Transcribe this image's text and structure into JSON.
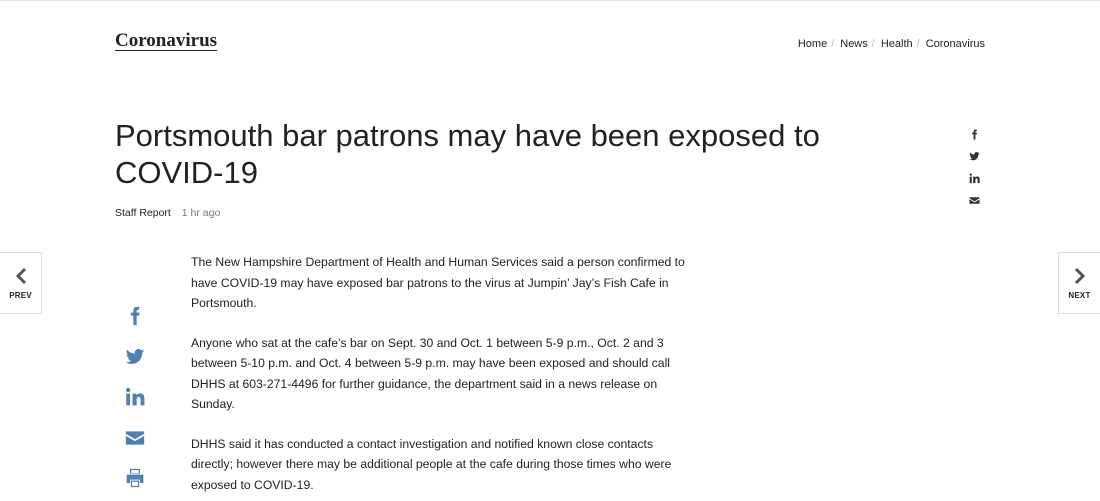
{
  "header": {
    "section_title": "Coronavirus",
    "breadcrumb": [
      {
        "label": "Home"
      },
      {
        "label": "News"
      },
      {
        "label": "Health"
      },
      {
        "label": "Coronavirus"
      }
    ],
    "separator": "/"
  },
  "article": {
    "headline": "Portsmouth bar patrons may have been exposed to COVID-19",
    "author": "Staff Report",
    "time": "1 hr ago",
    "paragraphs": [
      "The New Hampshire Department of Health and Human Services said a person confirmed to have COVID-19 may have exposed bar patrons to the virus at Jumpin’ Jay’s Fish Cafe in Portsmouth.",
      "Anyone who sat at the cafe’s bar on Sept. 30 and Oct. 1 between 5-9 p.m., Oct. 2 and 3 between 5-10 p.m. and Oct. 4 between 5-9 p.m. may have been exposed and should call DHHS at 603-271-4496 for further guidance, the department said in a news release on Sunday.",
      "DHHS said it has conducted a contact investigation and notified known close contacts directly; however there may be additional people at the cafe during those times who were exposed to COVID-19."
    ]
  },
  "share_top": {
    "icons": [
      "facebook-icon",
      "twitter-icon",
      "linkedin-icon",
      "email-icon"
    ],
    "color": "#333333"
  },
  "share_side": {
    "icons": [
      "facebook-icon",
      "twitter-icon",
      "linkedin-icon",
      "email-icon",
      "print-icon"
    ],
    "color": "#4e7fb8"
  },
  "nav": {
    "prev_label": "PREV",
    "next_label": "NEXT"
  }
}
